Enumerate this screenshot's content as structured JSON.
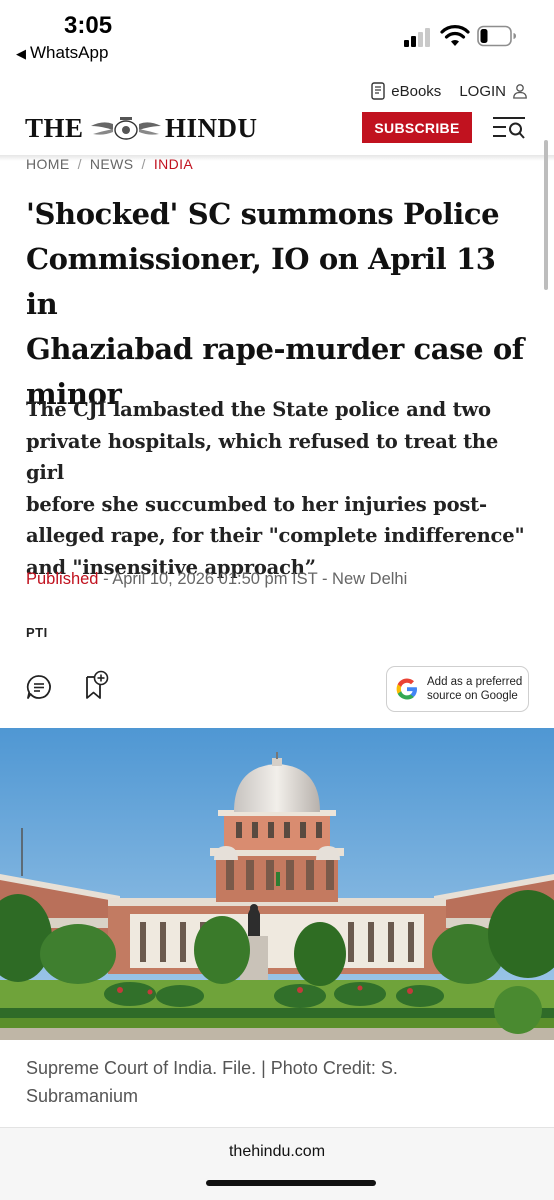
{
  "status_bar": {
    "time": "3:05",
    "back_app": "WhatsApp",
    "back_icon": "back-triangle-icon",
    "signal_icon": "cellular-signal-icon",
    "wifi_icon": "wifi-icon",
    "battery_icon": "battery-icon",
    "battery_level": 0.25
  },
  "header": {
    "logo_word_left": "THE",
    "logo_word_right": "HINDU",
    "ebooks_label": "eBooks",
    "login_label": "LOGIN",
    "subscribe_label": "SUBSCRIBE",
    "menu_icon": "menu-search-icon",
    "accent_color": "#c1121f"
  },
  "breadcrumb": {
    "items": [
      "HOME",
      "NEWS",
      "INDIA"
    ],
    "separator": "/"
  },
  "article": {
    "headline_lines": [
      "'Shocked' SC summons Police",
      "Commissioner, IO on April 13 in",
      "Ghaziabad rape-murder case of",
      "minor"
    ],
    "summary_lines": [
      "The CJI lambasted the State police and two",
      "private hospitals, which refused to treat the girl",
      "before she succumbed to her injuries post-",
      "alleged rape, for their \"complete indifference\"",
      "and \"insensitive approach”"
    ],
    "published_label": "Published",
    "published_meta": " - April 10, 2026 01:50 pm IST - New Delhi",
    "agency": "PTI",
    "comment_icon": "comment-icon",
    "bookmark_icon": "bookmark-add-icon",
    "google_button": {
      "line1": "Add as a preferred",
      "line2": "source on Google",
      "icon": "google-g-icon"
    }
  },
  "photo": {
    "subject": "Supreme Court of India building",
    "caption_line1": "Supreme Court of India. File. | Photo Credit: S.",
    "caption_line2": "Subramanium"
  },
  "footer": {
    "domain": "thehindu.com"
  }
}
